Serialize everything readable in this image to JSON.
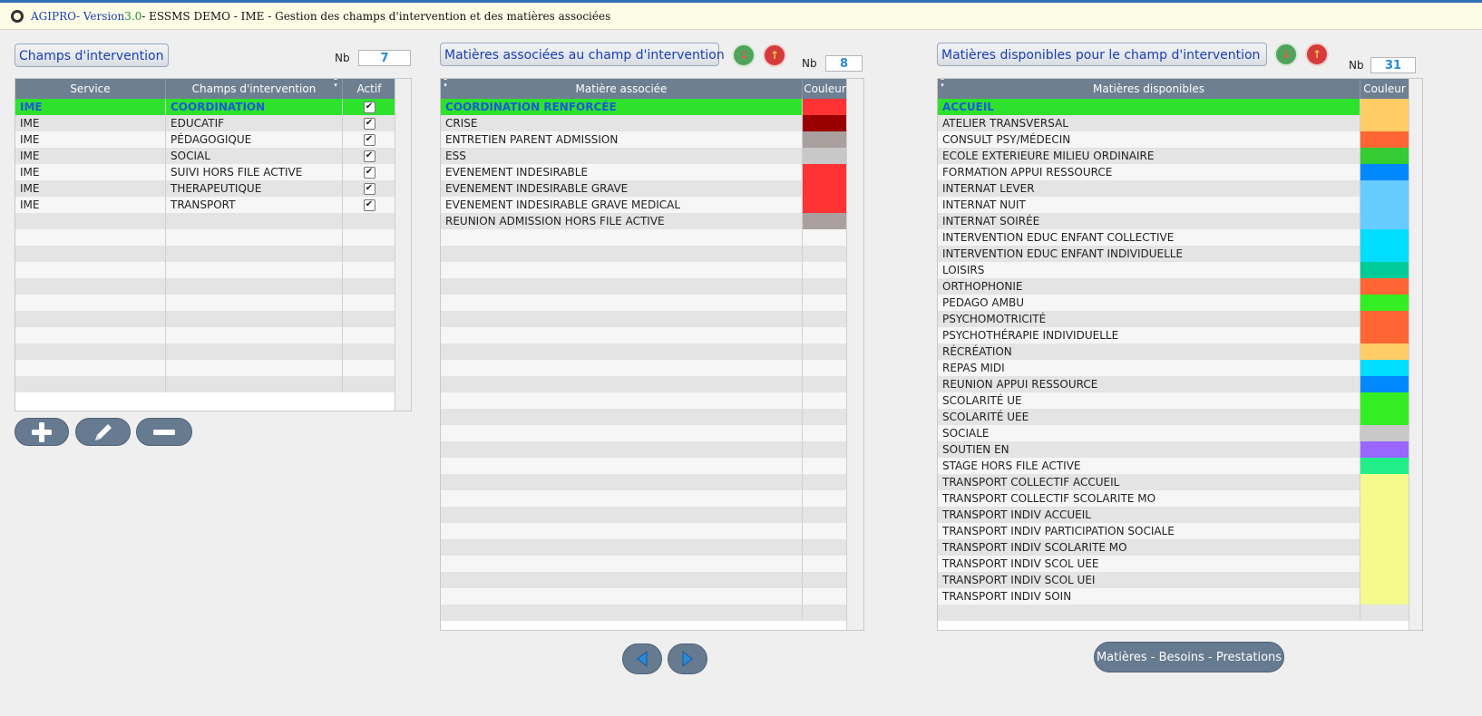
{
  "window": {
    "app": "AGIPRO",
    "version_prefix": " - Version ",
    "version": "3.0",
    "rest": " - ESSMS DEMO - IME - Gestion des champs d'intervention et des matières associées"
  },
  "panel1": {
    "label": "Champs d'intervention",
    "nb_label": "Nb",
    "nb": "7",
    "headers": {
      "service": "Service",
      "champ": "Champs d'intervention",
      "actif": "Actif"
    },
    "rows": [
      {
        "service": "IME",
        "champ": "COORDINATION",
        "actif": "✔"
      },
      {
        "service": "IME",
        "champ": "EDUCATIF",
        "actif": "✔"
      },
      {
        "service": "IME",
        "champ": "PÉDAGOGIQUE",
        "actif": "✔"
      },
      {
        "service": "IME",
        "champ": "SOCIAL",
        "actif": "✔"
      },
      {
        "service": "IME",
        "champ": "SUIVI HORS FILE ACTIVE",
        "actif": "✔"
      },
      {
        "service": "IME",
        "champ": "THERAPEUTIQUE",
        "actif": "✔"
      },
      {
        "service": "IME",
        "champ": "TRANSPORT",
        "actif": "✔"
      }
    ],
    "buttons": {
      "add": "plus-icon",
      "edit": "pencil-icon",
      "remove": "minus-icon"
    }
  },
  "panel2": {
    "label": "Matières associées au champ d'intervention",
    "nb_label": "Nb",
    "nb": "8",
    "headers": {
      "matiere": "Matière associée",
      "couleur": "Couleur"
    },
    "rows": [
      {
        "name": "COORDINATION RENFORCÉE",
        "color": "#ff3333"
      },
      {
        "name": "CRISE",
        "color": "#990000"
      },
      {
        "name": "ENTRETIEN PARENT ADMISSION",
        "color": "#aaa0a0"
      },
      {
        "name": "ESS",
        "color": "#c8c8c8"
      },
      {
        "name": "EVENEMENT INDESIRABLE",
        "color": "#ff3333"
      },
      {
        "name": "EVENEMENT INDESIRABLE GRAVE",
        "color": "#ff3333"
      },
      {
        "name": "EVENEMENT INDESIRABLE GRAVE MEDICAL",
        "color": "#ff3333"
      },
      {
        "name": "REUNION ADMISSION HORS FILE ACTIVE",
        "color": "#aaa0a0"
      }
    ]
  },
  "panel3": {
    "label": "Matières disponibles pour le champ d'intervention",
    "nb_label": "Nb",
    "nb": "31",
    "headers": {
      "matiere": "Matières disponibles",
      "couleur": "Couleur"
    },
    "rows": [
      {
        "name": "ACCUEIL",
        "color": "#ffcc66"
      },
      {
        "name": "ATELIER TRANSVERSAL",
        "color": "#ffcc66"
      },
      {
        "name": "CONSULT PSY/MÉDECIN",
        "color": "#ff6633"
      },
      {
        "name": "ECOLE EXTERIEURE MILIEU ORDINAIRE",
        "color": "#33cc33"
      },
      {
        "name": "FORMATION APPUI RESSOURCE",
        "color": "#0088ff"
      },
      {
        "name": "INTERNAT LEVER",
        "color": "#66ccff"
      },
      {
        "name": "INTERNAT NUIT",
        "color": "#66ccff"
      },
      {
        "name": "INTERNAT SOIRÉE",
        "color": "#66ccff"
      },
      {
        "name": "INTERVENTION EDUC ENFANT COLLECTIVE",
        "color": "#00ddff"
      },
      {
        "name": "INTERVENTION EDUC ENFANT INDIVIDUELLE",
        "color": "#00ddff"
      },
      {
        "name": "LOISIRS",
        "color": "#00cc99"
      },
      {
        "name": "ORTHOPHONIE",
        "color": "#ff6633"
      },
      {
        "name": "PEDAGO AMBU",
        "color": "#33ee22"
      },
      {
        "name": "PSYCHOMOTRICITÉ",
        "color": "#ff6633"
      },
      {
        "name": "PSYCHOTHÉRAPIE INDIVIDUELLE",
        "color": "#ff6633"
      },
      {
        "name": "RÉCRÉATION",
        "color": "#ffcc66"
      },
      {
        "name": "REPAS MIDI",
        "color": "#00ddff"
      },
      {
        "name": "REUNION APPUI RESSOURCE",
        "color": "#0088ff"
      },
      {
        "name": "SCOLARITÉ UE",
        "color": "#33ee22"
      },
      {
        "name": "SCOLARITÉ UEE",
        "color": "#33ee22"
      },
      {
        "name": "SOCIALE",
        "color": "#c8c8c8"
      },
      {
        "name": "SOUTIEN EN",
        "color": "#9966ff"
      },
      {
        "name": "STAGE HORS FILE ACTIVE",
        "color": "#22ee88"
      },
      {
        "name": "TRANSPORT COLLECTIF ACCUEIL",
        "color": "#f5fa8c"
      },
      {
        "name": "TRANSPORT COLLECTIF SCOLARITE MO",
        "color": "#f5fa8c"
      },
      {
        "name": "TRANSPORT INDIV ACCUEIL",
        "color": "#f5fa8c"
      },
      {
        "name": "TRANSPORT INDIV PARTICIPATION SOCIALE",
        "color": "#f5fa8c"
      },
      {
        "name": "TRANSPORT INDIV SCOLARITE MO",
        "color": "#f5fa8c"
      },
      {
        "name": "TRANSPORT INDIV SCOL UEE",
        "color": "#f5fa8c"
      },
      {
        "name": "TRANSPORT INDIV SCOL UEI",
        "color": "#f5fa8c"
      },
      {
        "name": "TRANSPORT INDIV SOIN",
        "color": "#f5fa8c"
      }
    ]
  },
  "footer": {
    "prev": "arrow-left-icon",
    "next": "arrow-right-icon",
    "matieres_button": "Matières - Besoins - Prestations"
  },
  "colors": {
    "selected_row": "#2de12d",
    "header": "#6e7f92",
    "button": "#667a90"
  }
}
